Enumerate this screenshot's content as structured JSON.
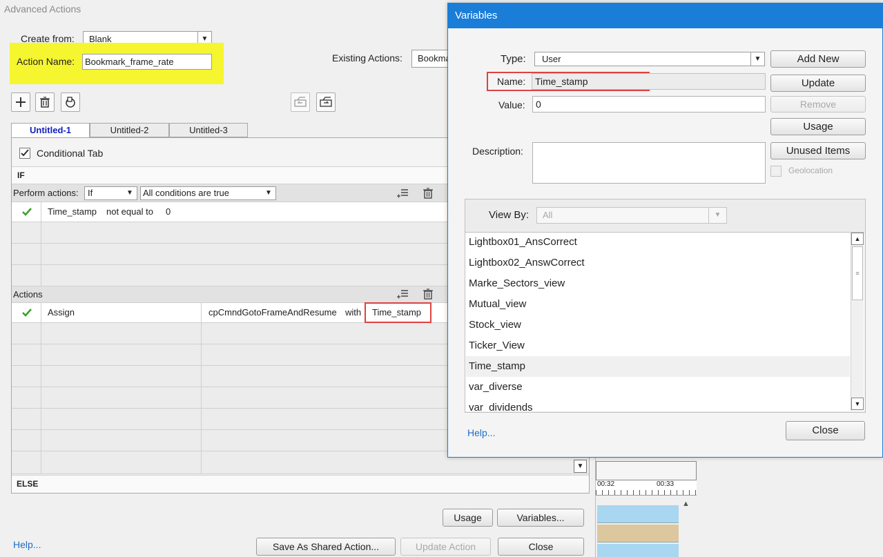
{
  "advanced_actions": {
    "window_title": "Advanced Actions",
    "create_from_label": "Create from:",
    "create_from_value": "Blank",
    "action_name_label": "Action Name:",
    "action_name_value": "Bookmark_frame_rate",
    "existing_actions_label": "Existing Actions:",
    "existing_actions_value": "Bookmar",
    "tabs": [
      {
        "label": "Untitled-1",
        "active": true
      },
      {
        "label": "Untitled-2",
        "active": false
      },
      {
        "label": "Untitled-3",
        "active": false
      }
    ],
    "conditional_tab_label": "Conditional Tab",
    "conditional_tab_checked": true,
    "if_label": "IF",
    "perform_actions_label": "Perform actions:",
    "perform_if_value": "If",
    "conditions_value": "All conditions are true",
    "condition_row": {
      "variable": "Time_stamp",
      "operator": "not equal to",
      "value": "0"
    },
    "actions_label": "Actions",
    "action_row": {
      "action": "Assign",
      "target": "cpCmndGotoFrameAndResume",
      "with_label": "with",
      "source": "Time_stamp"
    },
    "else_label": "ELSE",
    "usage_button": "Usage",
    "variables_button": "Variables...",
    "help_link": "Help...",
    "save_shared_button": "Save As Shared Action...",
    "update_action_button": "Update Action",
    "close_button": "Close"
  },
  "timeline": {
    "tick_1": "00:32",
    "tick_2": "00:33"
  },
  "variables_dialog": {
    "title": "Variables",
    "type_label": "Type:",
    "type_value": "User",
    "name_label": "Name:",
    "name_value": "Time_stamp",
    "value_label": "Value:",
    "value_value": "0",
    "description_label": "Description:",
    "description_value": "",
    "add_new_button": "Add New",
    "update_button": "Update",
    "remove_button": "Remove",
    "usage_button": "Usage",
    "unused_items_button": "Unused Items",
    "geolocation_label": "Geolocation",
    "view_by_label": "View By:",
    "view_by_value": "All",
    "variables": [
      "Lightbox01_AnsCorrect",
      "Lightbox02_AnswCorrect",
      "Marke_Sectors_view",
      "Mutual_view",
      "Stock_view",
      "Ticker_View",
      "Time_stamp",
      "var_diverse",
      "var_dividends"
    ],
    "selected_variable": "Time_stamp",
    "help_link": "Help...",
    "close_button": "Close"
  },
  "colors": {
    "dialog_title_bar": "#1a7dd8",
    "highlight_yellow": "#f5f530",
    "highlight_box_red": "#e04040",
    "check_green": "#3aa02a",
    "link_blue": "#1e6ec8",
    "active_tab_blue": "#1020c0"
  }
}
